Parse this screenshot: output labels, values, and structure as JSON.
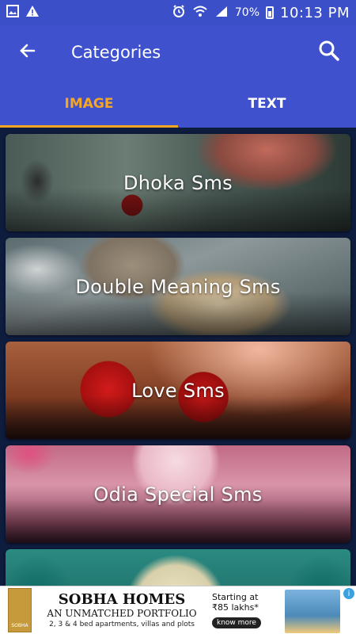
{
  "status_bar": {
    "battery_percent": "70%",
    "time": "10:13 PM",
    "icons": [
      "gallery-icon",
      "warning-icon",
      "alarm-icon",
      "wifi-icon",
      "signal-icon",
      "battery-icon"
    ]
  },
  "app_bar": {
    "title": "Categories",
    "back_icon": "back-arrow-icon",
    "search_icon": "search-icon"
  },
  "tabs": [
    {
      "label": "IMAGE",
      "active": true
    },
    {
      "label": "TEXT",
      "active": false
    }
  ],
  "categories": [
    {
      "label": "Dhoka Sms"
    },
    {
      "label": "Double Meaning Sms"
    },
    {
      "label": "Love Sms"
    },
    {
      "label": "Odia Special Sms"
    },
    {
      "label": ""
    }
  ],
  "ad": {
    "title": "SOBHA HOMES",
    "subtitle": "AN UNMATCHED PORTFOLIO",
    "line": "2, 3 & 4 bed apartments, villas and plots",
    "starting": "Starting at",
    "price": "₹85 lakhs*",
    "cta": "know more",
    "logo_text": "SOBHA",
    "info_icon": "info-icon"
  },
  "colors": {
    "accent": "#3f51cc",
    "tab_active": "#f5a623"
  }
}
